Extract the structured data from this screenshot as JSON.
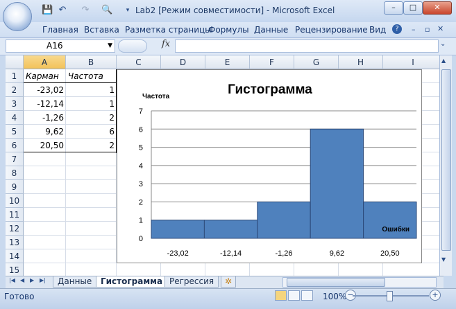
{
  "window": {
    "title": "Lab2  [Режим совместимости] - Microsoft Excel",
    "controls": [
      "–",
      "□",
      "✕"
    ]
  },
  "quick_access": {
    "icons": [
      "save-icon",
      "undo-icon",
      "redo-icon",
      "print-preview-icon",
      "customize-icon"
    ]
  },
  "ribbon": {
    "tabs": [
      "Главная",
      "Вставка",
      "Разметка страницы",
      "Формулы",
      "Данные",
      "Рецензирование",
      "Вид"
    ],
    "help": "?"
  },
  "formula_bar": {
    "name_box": "A16",
    "fx": "fx",
    "value": ""
  },
  "columns": [
    "A",
    "B",
    "C",
    "D",
    "E",
    "F",
    "G",
    "H",
    "I"
  ],
  "rows": [
    "1",
    "2",
    "3",
    "4",
    "5",
    "6",
    "7",
    "8",
    "9",
    "10",
    "11",
    "12",
    "13",
    "14",
    "15"
  ],
  "selected": {
    "column": "A",
    "row": "16"
  },
  "table": {
    "headers": [
      "Карман",
      "Частота"
    ],
    "rows": [
      [
        "-23,02",
        "1"
      ],
      [
        "-12,14",
        "1"
      ],
      [
        "-1,26",
        "2"
      ],
      [
        "9,62",
        "6"
      ],
      [
        "20,50",
        "2"
      ]
    ]
  },
  "chart_data": {
    "type": "bar",
    "title": "Гистограмма",
    "ylabel": "Частота",
    "xlabel": "Ошибки",
    "categories": [
      "-23,02",
      "-12,14",
      "-1,26",
      "9,62",
      "20,50"
    ],
    "values": [
      1,
      1,
      2,
      6,
      2
    ],
    "ylim": [
      0,
      7
    ],
    "yticks": [
      "0",
      "1",
      "2",
      "3",
      "4",
      "5",
      "6",
      "7"
    ],
    "grid": true,
    "bar_color": "#4f81bd"
  },
  "sheets": [
    "Данные",
    "Гистограмма",
    "Регрессия"
  ],
  "active_sheet": "Гистограмма",
  "status": {
    "ready": "Готово",
    "zoom": "100%",
    "zoom_minus": "−",
    "zoom_plus": "+"
  }
}
